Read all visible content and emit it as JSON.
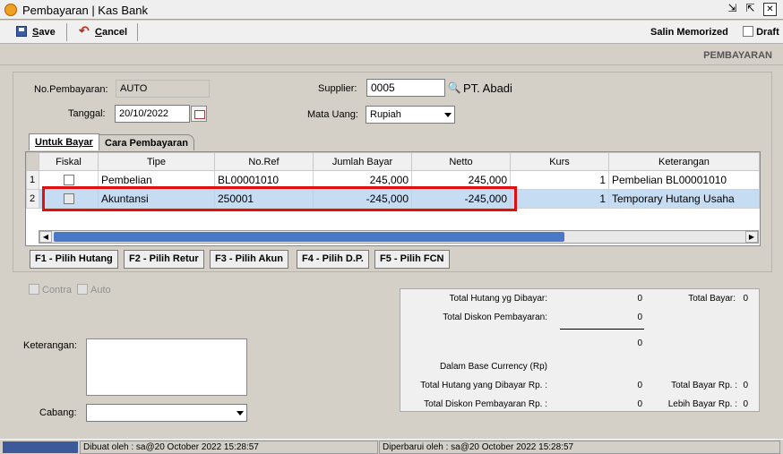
{
  "window": {
    "title": "Pembayaran | Kas Bank"
  },
  "toolbar": {
    "save_label": "ave",
    "save_key": "S",
    "cancel_label": "ancel",
    "cancel_key": "C",
    "memorized_label": "Salin Memorized",
    "draft_label": "Draft"
  },
  "page_title": "PEMBAYARAN",
  "form": {
    "no_label": "No.Pembayaran:",
    "no_value": "AUTO",
    "tanggal_label": "Tanggal:",
    "tanggal_value": "20/10/2022",
    "supplier_label": "Supplier:",
    "supplier_value": "0005",
    "supplier_name": "PT. Abadi",
    "mata_uang_label": "Mata Uang:",
    "mata_uang_value": "Rupiah"
  },
  "tabs": [
    {
      "label": "Untuk Bayar"
    },
    {
      "label": "Cara Pembayaran"
    }
  ],
  "grid": {
    "columns": [
      "Fiskal",
      "Tipe",
      "No.Ref",
      "Jumlah Bayar",
      "Netto",
      "Kurs",
      "Keterangan"
    ],
    "rows": [
      {
        "rn": "1",
        "tipe": "Pembelian",
        "noref": "BL00001010",
        "jumlah": "245,000",
        "netto": "245,000",
        "kurs": "1",
        "ket": "Pembelian BL00001010"
      },
      {
        "rn": "2",
        "tipe": "Akuntansi",
        "noref": "250001",
        "jumlah": "-245,000",
        "netto": "-245,000",
        "kurs": "1",
        "ket": "Temporary Hutang Usaha"
      }
    ]
  },
  "function_buttons": [
    "F1 - Pilih Hutang",
    "F2 - Pilih Retur",
    "F3 - Pilih Akun",
    "F4 - Pilih D.P.",
    "F5 - Pilih FCN"
  ],
  "options": {
    "contra": "Contra",
    "auto": "Auto"
  },
  "keterangan_label": "Keterangan:",
  "cabang_label": "Cabang:",
  "summary": {
    "total_hutang_label": "Total Hutang yg Dibayar:",
    "total_hutang_value": "0",
    "total_bayar_label": "Total Bayar:",
    "total_bayar_value": "0",
    "total_diskon_label": "Total Diskon Pembayaran:",
    "total_diskon_value": "0",
    "net_value": "0",
    "base_currency_label": "Dalam Base Currency (Rp)",
    "hutang_rp_label": "Total Hutang yang Dibayar Rp. :",
    "hutang_rp_value": "0",
    "bayar_rp_label": "Total Bayar Rp. :",
    "bayar_rp_value": "0",
    "diskon_rp_label": "Total Diskon Pembayaran Rp. :",
    "diskon_rp_value": "0",
    "lebih_label": "Lebih Bayar Rp. :",
    "lebih_value": "0"
  },
  "status": {
    "created": "Dibuat oleh : sa@20 October 2022  15:28:57",
    "updated": "Diperbarui oleh : sa@20 October 2022  15:28:57"
  }
}
